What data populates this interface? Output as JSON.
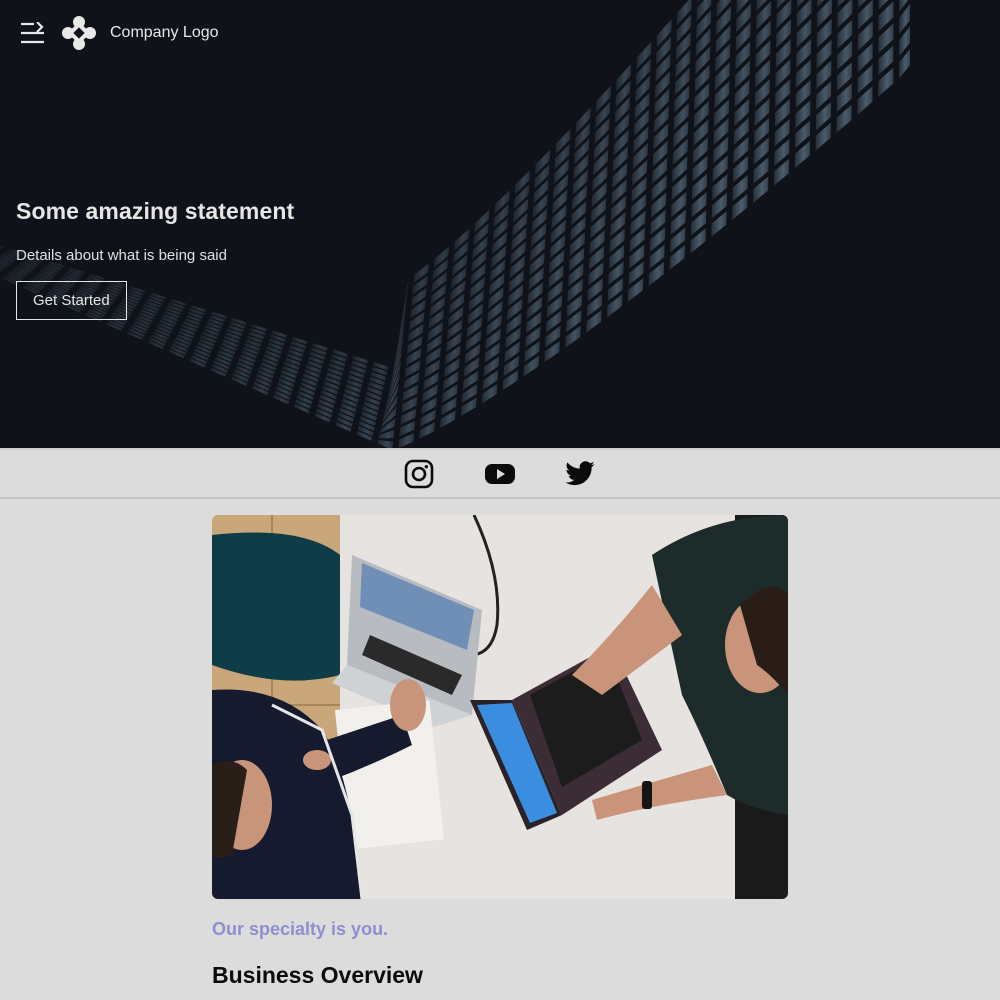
{
  "header": {
    "menu_icon": "menu-toggle-icon",
    "logo_icon": "company-logo-icon",
    "company_name": "Company Logo"
  },
  "hero": {
    "title": "Some amazing statement",
    "subtitle": "Details about what is being said",
    "cta_label": "Get Started",
    "background_color": "#0f1218"
  },
  "social": {
    "links": [
      {
        "icon": "instagram-icon"
      },
      {
        "icon": "youtube-icon"
      },
      {
        "icon": "twitter-icon"
      }
    ]
  },
  "main": {
    "image_subject": "two people working on laptops at a white table",
    "tagline": "Our specialty is you.",
    "section_title": "Business Overview",
    "tagline_color": "#8f8fcf"
  }
}
